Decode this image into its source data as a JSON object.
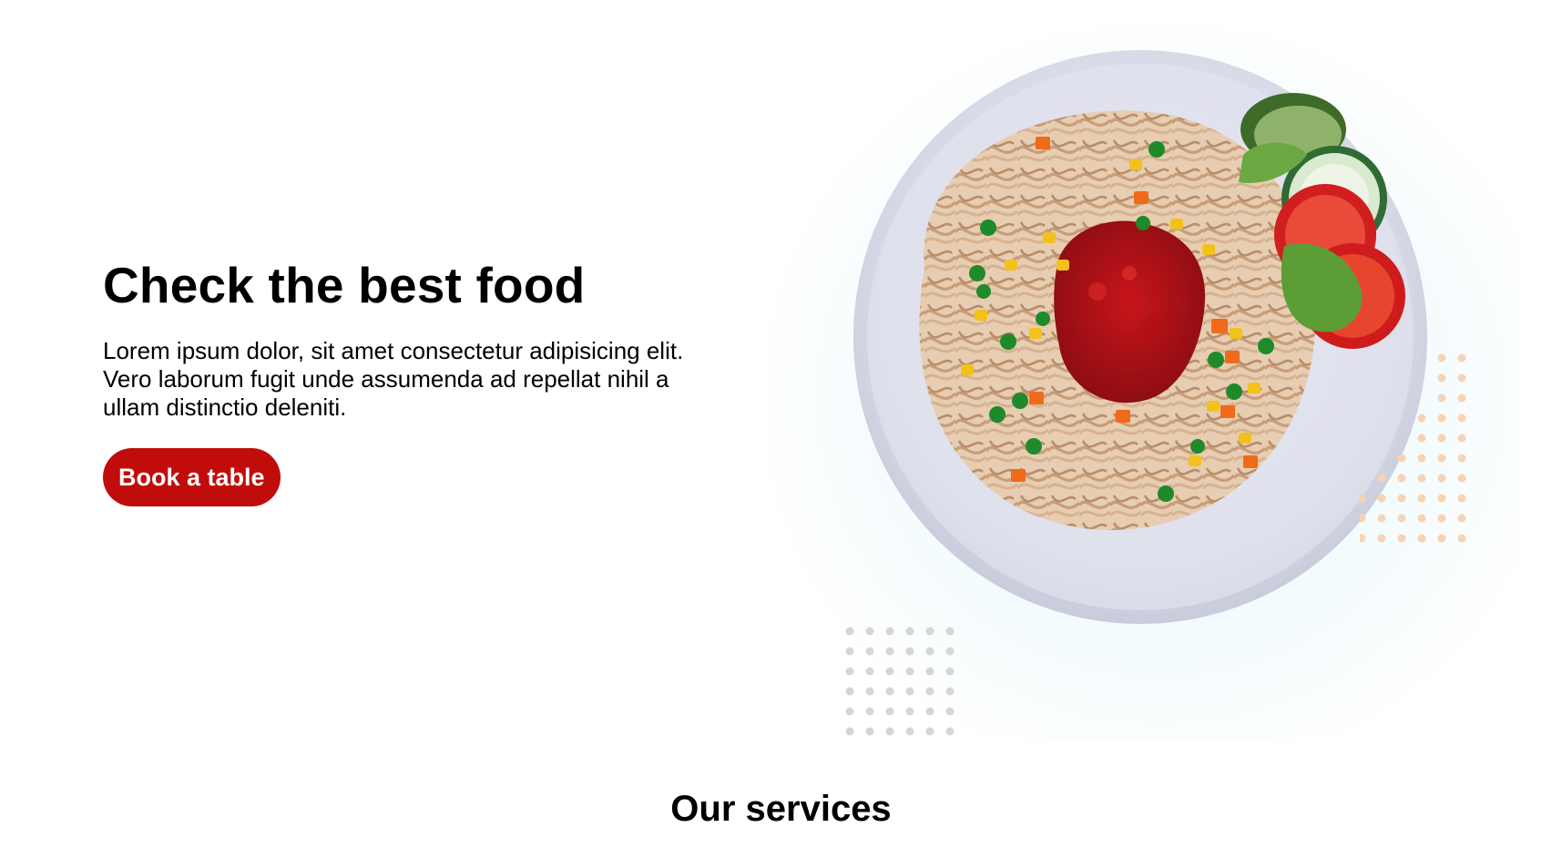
{
  "hero": {
    "title": "Check the best food",
    "description": "Lorem ipsum dolor, sit amet consectetur adipisicing elit. Vero laborum fugit unde assumenda ad repellat nihil a ullam distinctio deleniti.",
    "cta_label": "Book a table",
    "image": "pasta-plate-image"
  },
  "services": {
    "title": "Our services"
  },
  "colors": {
    "accent": "#c10c0c",
    "text": "#000000",
    "dots_gray": "#d6d6d6",
    "dots_orange": "#f7d3b3"
  }
}
